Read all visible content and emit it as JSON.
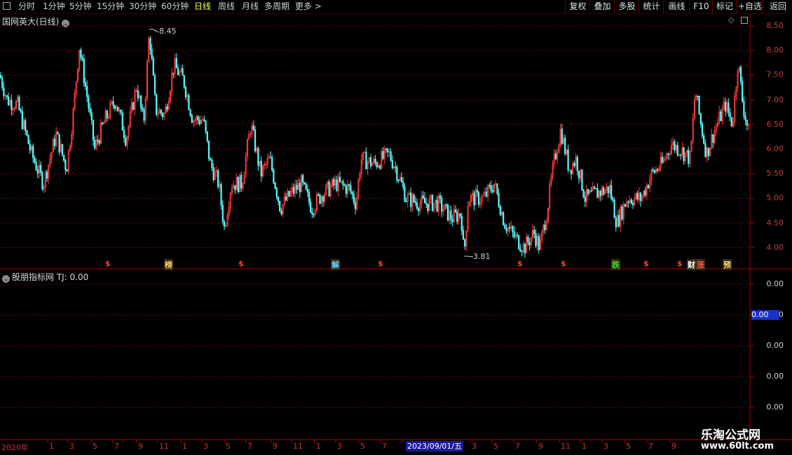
{
  "toolbar": {
    "periods": [
      "分时",
      "1分钟",
      "5分钟",
      "15分钟",
      "30分钟",
      "60分钟",
      "日线",
      "周线",
      "月线",
      "多周期",
      "更多 >"
    ],
    "active_period": "日线",
    "right_buttons": [
      "复权",
      "叠加",
      "多股",
      "统计",
      "画线",
      "F10",
      "标记",
      "+自选",
      "返回"
    ]
  },
  "main_panel": {
    "title": "国网英大(日线)",
    "y_labels": [
      "8.50",
      "8.00",
      "7.50",
      "7.00",
      "6.50",
      "6.00",
      "5.50",
      "5.00",
      "4.50",
      "4.00"
    ],
    "high_label": "8.45",
    "low_label": "3.81",
    "markers": [
      {
        "text": "$",
        "color": "#ff3b3b"
      },
      {
        "text": "榜",
        "color": "#ffd27a"
      },
      {
        "text": "$",
        "color": "#ff3b3b"
      },
      {
        "text": "解",
        "color": "#5ad6ff"
      },
      {
        "text": "$",
        "color": "#ff3b3b"
      },
      {
        "text": "$",
        "color": "#ff3b3b"
      },
      {
        "text": "$",
        "color": "#ff3b3b"
      },
      {
        "text": "跌",
        "color": "#38e038"
      },
      {
        "text": "$",
        "color": "#ff3b3b"
      },
      {
        "text": "$",
        "color": "#ff3b3b"
      },
      {
        "text": "财",
        "color": "#ffffff"
      },
      {
        "text": "涨",
        "color": "#ff5050"
      },
      {
        "text": "预",
        "color": "#ffd27a"
      }
    ]
  },
  "indicator_panel": {
    "title": "股朋指标网 TJ: 0.00",
    "y_labels": [
      "0.00",
      "0.00",
      "0.00",
      "0.00",
      "0.00"
    ],
    "current_value": "0.00"
  },
  "x_axis": {
    "labels": [
      "2020年",
      "1",
      "3",
      "5",
      "7",
      "9",
      "11",
      "1",
      "3",
      "5",
      "7",
      "9",
      "11",
      "1",
      "3",
      "5",
      "7",
      "3",
      "5",
      "7",
      "9",
      "11",
      "1",
      "3",
      "5",
      "7",
      "9"
    ],
    "cursor_date": "2023/09/01/五"
  },
  "watermark": {
    "line1": "乐淘公式网",
    "line2": "www.60lt.com"
  },
  "colors": {
    "up": "#ff3b3b",
    "down": "#54ffff",
    "grid": "#7a0000",
    "axis_text": "#c04040",
    "active_tab": "#ffff54"
  }
}
